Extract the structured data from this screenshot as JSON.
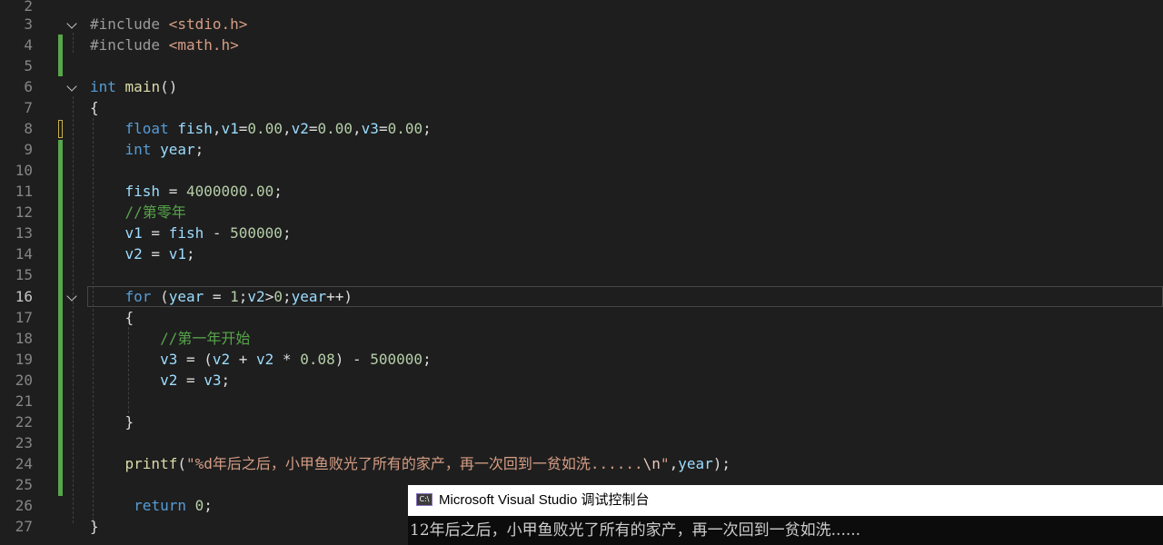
{
  "editor": {
    "lines": [
      {
        "n": "2",
        "text": ""
      },
      {
        "n": "3",
        "text": "#include <stdio.h>"
      },
      {
        "n": "4",
        "text": "#include <math.h>"
      },
      {
        "n": "5",
        "text": ""
      },
      {
        "n": "6",
        "text": "int main()"
      },
      {
        "n": "7",
        "text": "{"
      },
      {
        "n": "8",
        "text": "    float fish,v1=0.00,v2=0.00,v3=0.00;"
      },
      {
        "n": "9",
        "text": "    int year;"
      },
      {
        "n": "10",
        "text": ""
      },
      {
        "n": "11",
        "text": "    fish = 4000000.00;"
      },
      {
        "n": "12",
        "text": "    //第零年"
      },
      {
        "n": "13",
        "text": "    v1 = fish - 500000;"
      },
      {
        "n": "14",
        "text": "    v2 = v1;"
      },
      {
        "n": "15",
        "text": ""
      },
      {
        "n": "16",
        "text": "    for (year = 1;v2>0;year++)"
      },
      {
        "n": "17",
        "text": "    {"
      },
      {
        "n": "18",
        "text": "        //第一年开始"
      },
      {
        "n": "19",
        "text": "        v3 = (v2 + v2 * 0.08) - 500000;"
      },
      {
        "n": "20",
        "text": "        v2 = v3;"
      },
      {
        "n": "21",
        "text": ""
      },
      {
        "n": "22",
        "text": "    }"
      },
      {
        "n": "23",
        "text": ""
      },
      {
        "n": "24",
        "text": "    printf(\"%d年后之后，小甲鱼败光了所有的家产，再一次回到一贫如洗......\\n\",year);"
      },
      {
        "n": "25",
        "text": ""
      },
      {
        "n": "26",
        "text": "     return 0;"
      },
      {
        "n": "27",
        "text": "}"
      }
    ],
    "active_line": "16"
  },
  "console": {
    "title": "Microsoft Visual Studio 调试控制台",
    "icon": "console-app-icon",
    "icon_label": "C:\\",
    "output": "12年后之后，小甲鱼败光了所有的家产，再一次回到一贫如洗......"
  },
  "colors": {
    "background": "#1e1e1e",
    "keyword": "#569cd6",
    "string": "#d69d85",
    "number": "#b5cea8",
    "comment": "#57a64a",
    "variable": "#9cdcfe",
    "function": "#dcdcaa",
    "change_bar": "#57a64a"
  }
}
